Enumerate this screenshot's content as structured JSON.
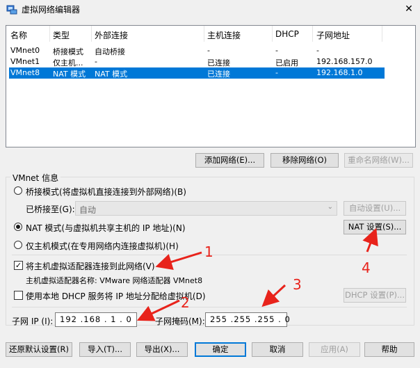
{
  "window": {
    "title": "虚拟网络编辑器",
    "close_label": "✕"
  },
  "table": {
    "columns": [
      "名称",
      "类型",
      "外部连接",
      "主机连接",
      "DHCP",
      "子网地址"
    ],
    "rows": [
      {
        "name": "VMnet0",
        "type": "桥接模式",
        "external": "自动桥接",
        "host": "-",
        "dhcp": "-",
        "subnet": "-"
      },
      {
        "name": "VMnet1",
        "type": "仅主机...",
        "external": "-",
        "host": "已连接",
        "dhcp": "已启用",
        "subnet": "192.168.157.0"
      },
      {
        "name": "VMnet8",
        "type": "NAT 模式",
        "external": "NAT 模式",
        "host": "已连接",
        "dhcp": "-",
        "subnet": "192.168.1.0"
      }
    ]
  },
  "network_buttons": {
    "add": "添加网络(E)...",
    "remove": "移除网络(O)",
    "rename": "重命名网络(W)..."
  },
  "vmnet_info": {
    "group_label": "VMnet 信息",
    "bridge_label": "桥接模式(将虚拟机直接连接到外部网络)(B)",
    "bridged_to_label": "已桥接至(G):",
    "bridged_to_value": "自动",
    "auto_settings": "自动设置(U)...",
    "nat_label": "NAT 模式(与虚拟机共享主机的 IP 地址)(N)",
    "nat_settings": "NAT 设置(S)...",
    "hostonly_label": "仅主机模式(在专用网络内连接虚拟机)(H)",
    "connect_adapter_label": "将主机虚拟适配器连接到此网络(V)",
    "adapter_name_label": "主机虚拟适配器名称: VMware 网络适配器 VMnet8",
    "dhcp_label": "使用本地 DHCP 服务将 IP 地址分配给虚拟机(D)",
    "dhcp_settings": "DHCP 设置(P)...",
    "subnet_ip_label": "子网 IP (I):",
    "subnet_ip_value": "192 .168 . 1 . 0",
    "subnet_mask_label": "子网掩码(M):",
    "subnet_mask_value": "255 .255 .255 . 0",
    "selected_mode": "nat",
    "connect_adapter_checked": true,
    "dhcp_checked": false
  },
  "footer_buttons": {
    "restore": "还原默认设置(R)",
    "import": "导入(T)...",
    "export": "导出(X)...",
    "ok": "确定",
    "cancel": "取消",
    "apply": "应用(A)",
    "help": "帮助"
  },
  "annotations": [
    "1",
    "2",
    "3",
    "4"
  ],
  "colors": {
    "selection": "#0078d7",
    "annotation": "#e8231b"
  }
}
